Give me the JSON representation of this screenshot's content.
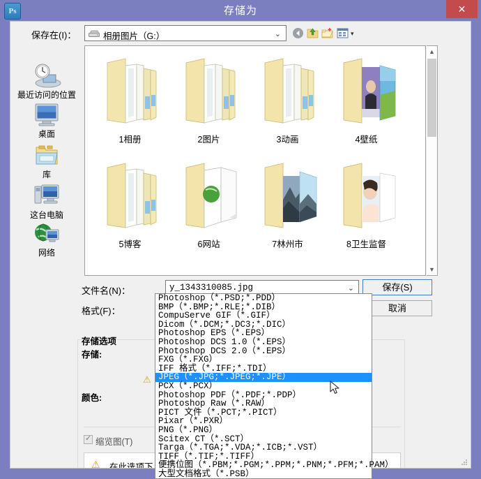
{
  "window": {
    "app_icon": "Ps",
    "title": "存储为",
    "close_label": "✕"
  },
  "toolbar": {
    "lookin_label": "保存在(I)：",
    "lookin_value": "相册图片（G:）",
    "icons": [
      {
        "name": "back-icon",
        "glyph": "◀"
      },
      {
        "name": "up-folder-icon",
        "glyph": "▲"
      },
      {
        "name": "new-folder-icon",
        "glyph": "✚"
      },
      {
        "name": "views-icon",
        "glyph": "▦"
      }
    ],
    "views_arrow": "▾"
  },
  "places": [
    {
      "label": "最近访问的位置",
      "icon": "recent-places-icon"
    },
    {
      "label": "桌面",
      "icon": "desktop-icon"
    },
    {
      "label": "库",
      "icon": "libraries-icon"
    },
    {
      "label": "这台电脑",
      "icon": "this-pc-icon"
    },
    {
      "label": "网络",
      "icon": "network-icon"
    }
  ],
  "files": [
    {
      "label": "1相册",
      "type": "folder-docs"
    },
    {
      "label": "2图片",
      "type": "folder-docs"
    },
    {
      "label": "3动画",
      "type": "folder-docs"
    },
    {
      "label": "4壁纸",
      "type": "folder-photos"
    },
    {
      "label": "5博客",
      "type": "folder-docs"
    },
    {
      "label": "6网站",
      "type": "folder-web"
    },
    {
      "label": "7林州市",
      "type": "folder-landscape"
    },
    {
      "label": "8卫生监督",
      "type": "folder-portrait"
    }
  ],
  "form": {
    "filename_label": "文件名(N)：",
    "filename_value": "y_1343310085.jpg",
    "format_label": "格式(F)：",
    "format_value": "JPEG（*.JPG;*.JPEG;*.JPE）",
    "save_button": "保存(S)",
    "cancel_button": "取消",
    "dropdown_arrow": "⌄"
  },
  "format_options": [
    "Photoshop（*.PSD;*.PDD）",
    "BMP（*.BMP;*.RLE;*.DIB）",
    "CompuServe GIF（*.GIF）",
    "Dicom（*.DCM;*.DC3;*.DIC）",
    "Photoshop EPS（*.EPS）",
    "Photoshop DCS 1.0（*.EPS）",
    "Photoshop DCS 2.0（*.EPS）",
    "FXG（*.FXG）",
    "IFF 格式（*.IFF;*.TDI）",
    "JPEG（*.JPG;*.JPEG;*.JPE）",
    "PCX（*.PCX）",
    "Photoshop PDF（*.PDF;*.PDP）",
    "Photoshop Raw（*.RAW）",
    "PICT 文件（*.PCT;*.PICT）",
    "Pixar（*.PXR）",
    "PNG（*.PNG）",
    "Scitex CT（*.SCT）",
    "Targa（*.TGA;*.VDA;*.ICB;*.VST）",
    "TIFF（*.TIF;*.TIFF）",
    "便携位图（*.PBM;*.PGM;*.PPM;*.PNM;*.PFM;*.PAM）",
    "大型文档格式（*.PSB）"
  ],
  "format_selected_index": 9,
  "save_options": {
    "group_title": "存储选项",
    "save_label": "存储:",
    "color_label": "颜色:",
    "thumbnail_label": "缩览图(T)",
    "warning_text": "在此选项下，文件必",
    "warning_icon": "⚠"
  },
  "colors": {
    "titlebar": "#7b7fc0",
    "close_button": "#c34b4b",
    "dialog_bg": "#f0f0f0",
    "selection_blue": "#1e90ff",
    "combo_focus": "#cfe0f5",
    "folder_yellow": "#f2e2a0"
  }
}
